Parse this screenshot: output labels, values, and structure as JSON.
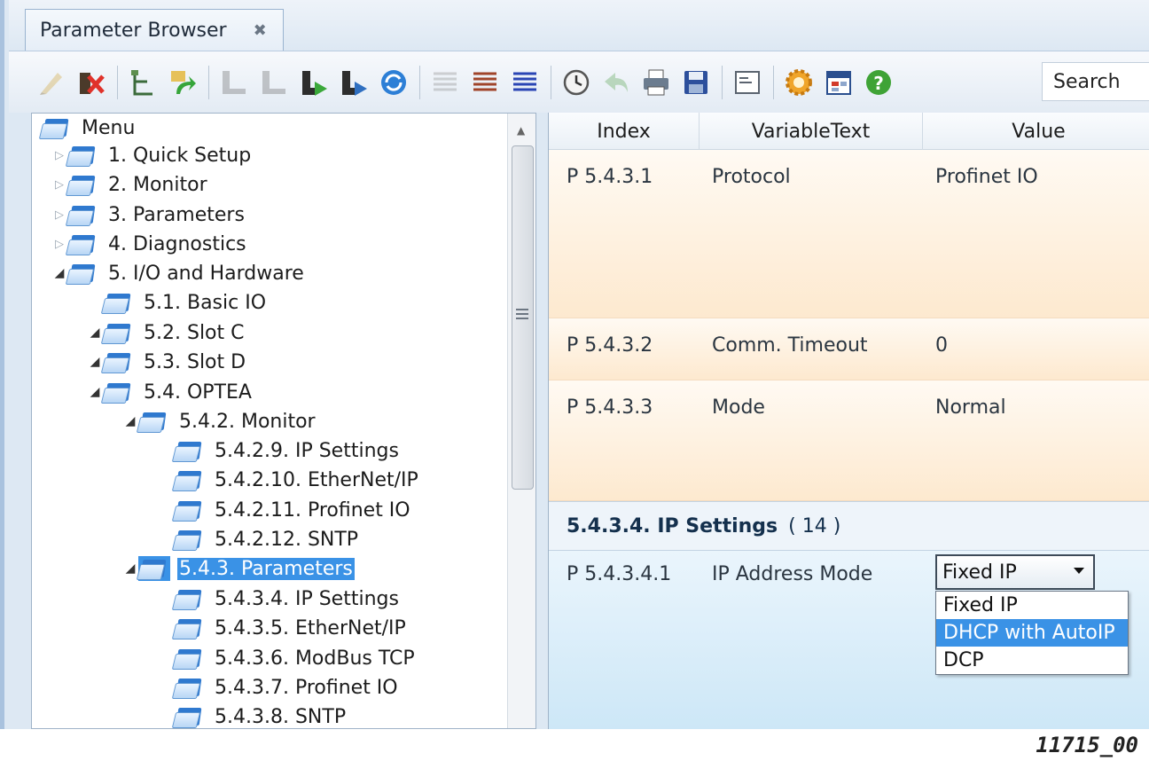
{
  "tab": {
    "title": "Parameter Browser",
    "close_glyph": "✖"
  },
  "toolbar": {
    "search_label": "Search",
    "icons": [
      "edit-icon",
      "delete-icon",
      "tree-icon",
      "refresh-green-icon",
      "download-disabled-icon",
      "upload-disabled-icon",
      "download-icon",
      "upload-icon",
      "sync-icon",
      "list-light-icon",
      "list-brown-icon",
      "list-blue-icon",
      "clock-icon",
      "back-icon",
      "print-icon",
      "save-icon",
      "window-icon",
      "settings-icon",
      "calendar-icon",
      "help-icon"
    ]
  },
  "tree": {
    "items": [
      {
        "label": "Menu"
      },
      {
        "label": "1. Quick Setup"
      },
      {
        "label": "2. Monitor"
      },
      {
        "label": "3. Parameters"
      },
      {
        "label": "4. Diagnostics"
      },
      {
        "label": "5. I/O and Hardware"
      },
      {
        "label": "5.1. Basic IO"
      },
      {
        "label": "5.2. Slot C"
      },
      {
        "label": "5.3. Slot D"
      },
      {
        "label": "5.4. OPTEA"
      },
      {
        "label": "5.4.2. Monitor"
      },
      {
        "label": "5.4.2.9. IP Settings"
      },
      {
        "label": "5.4.2.10. EtherNet/IP"
      },
      {
        "label": "5.4.2.11. Profinet IO"
      },
      {
        "label": "5.4.2.12. SNTP"
      },
      {
        "label": "5.4.3. Parameters"
      },
      {
        "label": "5.4.3.4. IP Settings"
      },
      {
        "label": "5.4.3.5. EtherNet/IP"
      },
      {
        "label": "5.4.3.6. ModBus TCP"
      },
      {
        "label": "5.4.3.7. Profinet IO"
      },
      {
        "label": "5.4.3.8. SNTP"
      }
    ],
    "selected": "5.4.3. Parameters"
  },
  "grid": {
    "columns": [
      "Index",
      "VariableText",
      "Value"
    ],
    "rows": [
      {
        "index": "P 5.4.3.1",
        "text": "Protocol",
        "value": "Profinet IO"
      },
      {
        "index": "P 5.4.3.2",
        "text": "Comm. Timeout",
        "value": "0"
      },
      {
        "index": "P 5.4.3.3",
        "text": "Mode",
        "value": "Normal"
      }
    ],
    "group": {
      "title": "5.4.3.4. IP Settings",
      "count": "( 14 )"
    },
    "ip_row": {
      "index": "P 5.4.3.4.1",
      "text": "IP Address Mode",
      "selected_value": "Fixed IP",
      "options": [
        "Fixed IP",
        "DHCP with AutoIP",
        "DCP"
      ],
      "highlighted_option": "DHCP with AutoIP"
    }
  },
  "figure_label": "11715_00",
  "colors": {
    "selection": "#3a92e6",
    "peach_row": "#fde9cf",
    "blue_row": "#cde7f7",
    "folder": "#2f79cf"
  }
}
